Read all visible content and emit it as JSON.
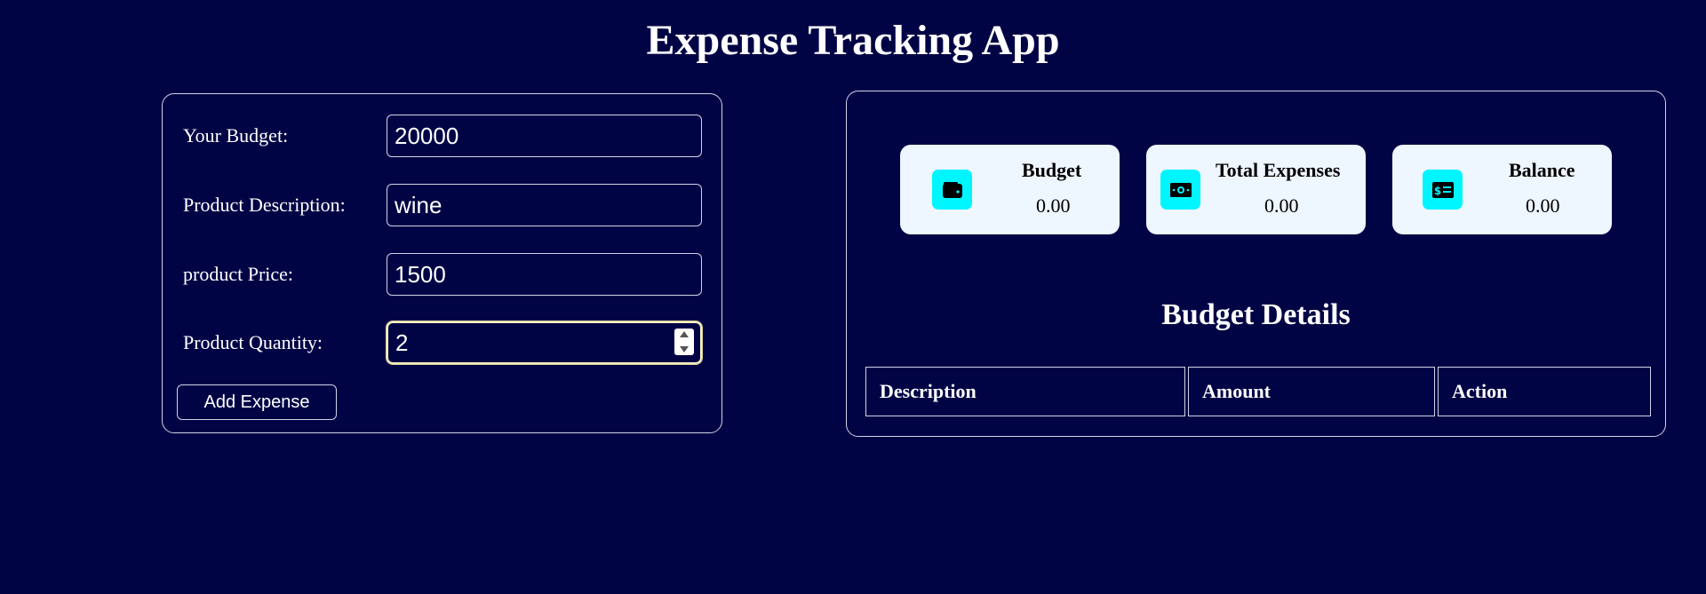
{
  "app": {
    "title": "Expense Tracking App"
  },
  "form": {
    "budget_label": "Your Budget:",
    "budget_value": "20000",
    "description_label": "Product Description:",
    "description_value": "wine",
    "price_label": "product Price:",
    "price_value": "1500",
    "quantity_label": "Product Quantity:",
    "quantity_value": "2",
    "add_button_label": "Add Expense"
  },
  "summary": {
    "cards": [
      {
        "title": "Budget",
        "value": "0.00",
        "icon": "wallet-icon"
      },
      {
        "title": "Total Expenses",
        "value": "0.00",
        "icon": "money-bill-icon"
      },
      {
        "title": "Balance",
        "value": "0.00",
        "icon": "money-check-icon"
      }
    ]
  },
  "details": {
    "title": "Budget Details",
    "columns": [
      "Description",
      "Amount",
      "Action"
    ]
  },
  "colors": {
    "background": "#000445",
    "card_background": "#eef6ff",
    "icon_accent": "#00f6ff",
    "border": "#cfd3e6"
  }
}
